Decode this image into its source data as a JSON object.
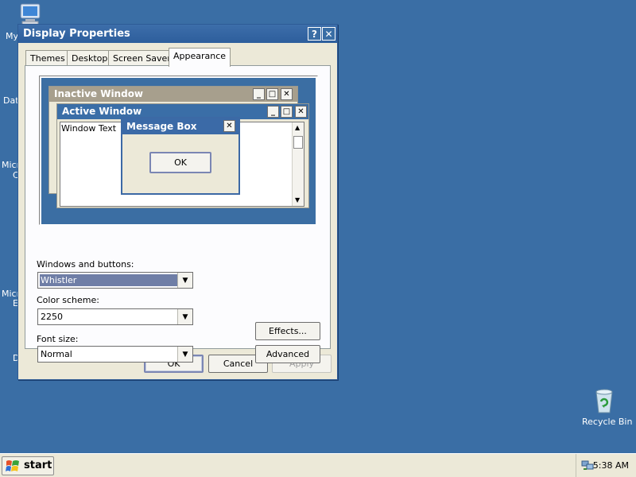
{
  "desktop": {
    "icons": [
      {
        "label": "My"
      },
      {
        "label": "Dat"
      },
      {
        "label": "Micr"
      },
      {
        "label": "C"
      },
      {
        "label": "Micr"
      },
      {
        "label": "E"
      },
      {
        "label": "D"
      }
    ],
    "recycle_bin": {
      "label": "Recycle Bin",
      "icon": "recycle-bin-icon"
    }
  },
  "dialog": {
    "title": "Display Properties",
    "help_glyph": "?",
    "close_glyph": "✕",
    "tabs": [
      {
        "label": "Themes"
      },
      {
        "label": "Desktop"
      },
      {
        "label": "Screen Saver"
      },
      {
        "label": "Appearance",
        "active": true
      }
    ],
    "preview": {
      "inactive_title": "Inactive Window",
      "active_title": "Active Window",
      "window_text": "Window Text",
      "message_box_title": "Message Box",
      "ok_label": "OK",
      "colors": {
        "inactive_title_bg": "#a79f8d",
        "active_title_bg": "#3a6ea7",
        "preview_bg": "#3b6ea3"
      }
    },
    "fields": {
      "windows_buttons": {
        "label": "Windows and buttons:",
        "value": "Whistler"
      },
      "color_scheme": {
        "label": "Color scheme:",
        "value": "2250"
      },
      "font_size": {
        "label": "Font size:",
        "value": "Normal"
      }
    },
    "effects_button": "Effects...",
    "advanced_button": "Advanced",
    "ok_button": "OK",
    "cancel_button": "Cancel",
    "apply_button": "Apply"
  },
  "taskbar": {
    "start_label": "start",
    "clock": "5:38 AM"
  },
  "colors": {
    "desktop": "#3a6ea5",
    "titlebar": "#3d6eaa",
    "dialog_face": "#ece9d8"
  }
}
